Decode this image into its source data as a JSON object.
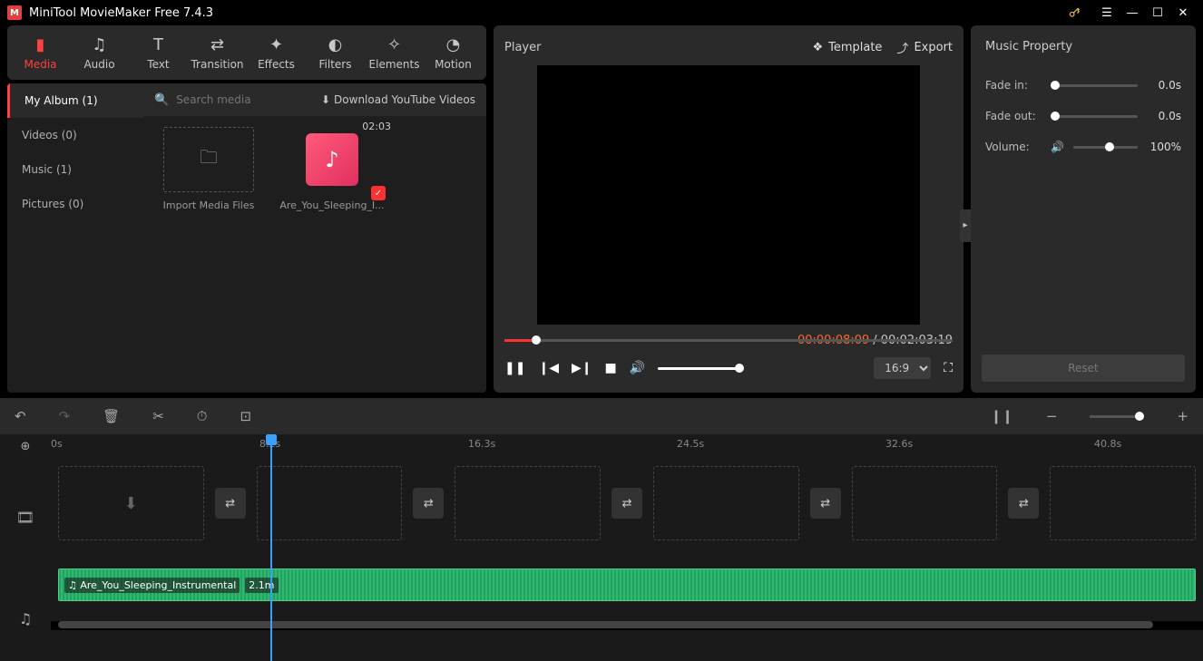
{
  "app": {
    "title": "MiniTool MovieMaker Free 7.4.3"
  },
  "tabs": [
    {
      "label": "Media",
      "icon": "folder"
    },
    {
      "label": "Audio",
      "icon": "music"
    },
    {
      "label": "Text",
      "icon": "text"
    },
    {
      "label": "Transition",
      "icon": "swap"
    },
    {
      "label": "Effects",
      "icon": "fx"
    },
    {
      "label": "Filters",
      "icon": "filter"
    },
    {
      "label": "Elements",
      "icon": "sparkle"
    },
    {
      "label": "Motion",
      "icon": "motion"
    }
  ],
  "sidebar": {
    "items": [
      {
        "label": "My Album (1)"
      },
      {
        "label": "Videos (0)"
      },
      {
        "label": "Music (1)"
      },
      {
        "label": "Pictures (0)"
      }
    ]
  },
  "search": {
    "placeholder": "Search media",
    "ytlink": "Download YouTube Videos"
  },
  "thumbs": {
    "import_label": "Import Media Files",
    "clip_name": "Are_You_Sleeping_I...",
    "clip_duration": "02:03"
  },
  "player": {
    "title": "Player",
    "template_label": "Template",
    "export_label": "Export",
    "current_time": "00:00:08:09",
    "total_time": "00:02:03:19",
    "aspect": "16:9"
  },
  "props": {
    "title": "Music Property",
    "fade_in_label": "Fade in:",
    "fade_in_value": "0.0s",
    "fade_out_label": "Fade out:",
    "fade_out_value": "0.0s",
    "volume_label": "Volume:",
    "volume_value": "100%",
    "reset_label": "Reset"
  },
  "ruler": {
    "ticks": [
      {
        "label": "0s",
        "pos": 0
      },
      {
        "label": "8.2s",
        "pos": 230
      },
      {
        "label": "16.3s",
        "pos": 460
      },
      {
        "label": "24.5s",
        "pos": 690
      },
      {
        "label": "32.6s",
        "pos": 920
      },
      {
        "label": "40.8s",
        "pos": 1150
      }
    ]
  },
  "audio_clip": {
    "name": "Are_You_Sleeping_Instrumental",
    "duration": "2.1m"
  }
}
